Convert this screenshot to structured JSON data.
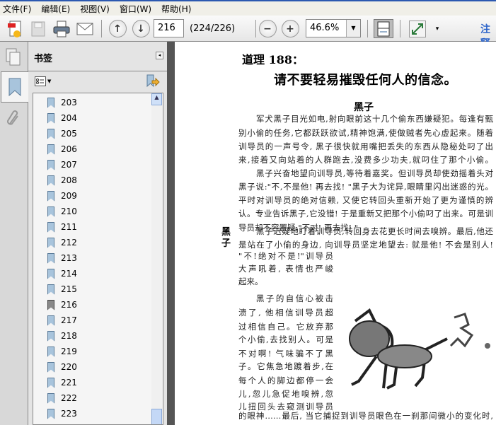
{
  "menu": [
    "文件(F)",
    "编辑(E)",
    "视图(V)",
    "窗口(W)",
    "帮助(H)"
  ],
  "toolbar": {
    "page_value": "216",
    "page_count": "(224/226)",
    "zoom_value": "46.6%",
    "annotate_label": "注释"
  },
  "panel": {
    "title": "书签",
    "bookmarks": [
      "203",
      "204",
      "205",
      "206",
      "207",
      "208",
      "209",
      "210",
      "211",
      "212",
      "213",
      "214",
      "215",
      "216",
      "217",
      "218",
      "219",
      "220",
      "221",
      "222",
      "223"
    ],
    "current": "216"
  },
  "document": {
    "heading": "道理 188：",
    "subheading": "请不要轻易摧毁任何人的信念。",
    "story_title": "黑子",
    "side_label": "黑子",
    "full_lines": [
      "军犬黑子目光如电,射向眼前这十几个偷东西嫌疑犯。每逢有甄",
      "别小偷的任务,它都跃跃欲试,精神饱满,使做贼者先心虚起来。随着",
      "训导员的一声号令, 黑子很快就用嘴把丢失的东西从隐秘处叼了出",
      "来,接着又向站着的人群跑去,没费多少功夫,就叼住了那个小偷。",
      "黑子兴奋地望向训导员,等待着嘉奖。但训导员却使劲摇着头对",
      "黑子说:\"不,不是他! 再去找! \"黑子大为诧异,眼睛里闪出迷惑的光。",
      "平时对训导员的绝对信赖, 又使它转回头重新开始了更为谨慎的辨",
      "认。专业告诉黑子,它没错! 于是重新又把那个小偷叼了出来。可是训",
      "导员却不容置疑:\"不对! 再去找! \"",
      "黑子迟疑地盯着训导员,转回身去花更长时间去嗅辨。最后,他还",
      "是站在了小偷的身边, 向训导员坚定地望去: 就是他! 不会是别人!"
    ],
    "narrow_lines": [
      "\"不!绝对不是!\"训导员",
      "大声吼着, 表情也严峻",
      "起来。",
      "黑子的自信心被击",
      "溃了, 他相信训导员超",
      "过相信自己。它放弃那",
      "个小偷,去找别人。可是",
      "不对啊! 气味骗不了黑",
      "子。它焦急地踱着步,在",
      "每个人的脚边都停一会",
      "儿,忽儿急促地嗅辨,忽",
      "儿扭回头去窥测训导员"
    ],
    "last_line": "的眼神……最后, 当它捕捉到训导员眼色在一刹那间微小的变化时,"
  }
}
